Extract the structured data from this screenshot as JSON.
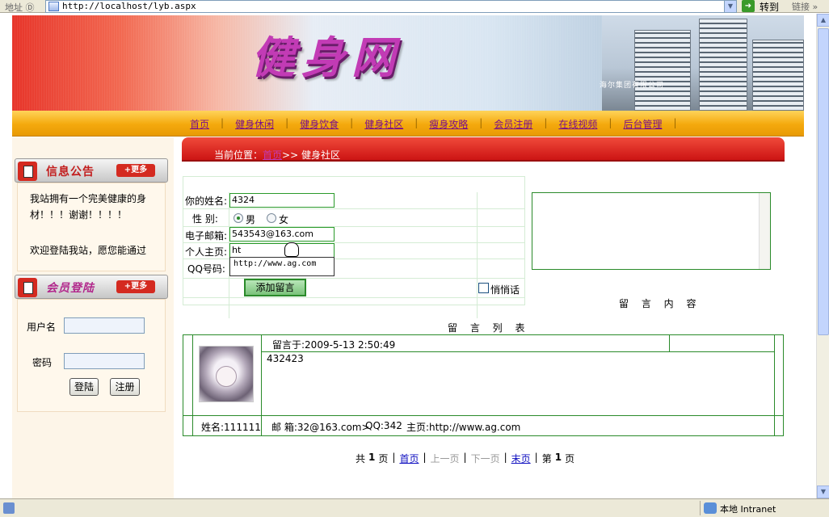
{
  "browser": {
    "address_label": "地址 Ⓓ",
    "url": "http://localhost/lyb.aspx",
    "go_label": "转到",
    "links_label": "链接",
    "arrow": "»",
    "status_zone": "本地 Intranet"
  },
  "banner": {
    "title": "健身网",
    "caption": "海尔集团有限公司"
  },
  "nav": {
    "items": [
      "首页",
      "健身休闲",
      "健身饮食",
      "健身社区",
      "瘦身攻略",
      "会员注册",
      "在线视频",
      "后台管理"
    ]
  },
  "left": {
    "notice_title": "信息公告",
    "more_label": "+更多",
    "notice_lines": [
      "我站拥有一个完美健康的身",
      "材！！！谢谢！！！！",
      "欢迎登陆我站，愿您能通过"
    ],
    "login_title": "会员登陆",
    "username_label": "用户名",
    "password_label": "密码",
    "login_button": "登陆",
    "register_button": "注册"
  },
  "main": {
    "crumb_prefix": "当前位置：",
    "crumb_link": "首页",
    "crumb_suffix": ">> 健身社区",
    "form": {
      "name_label": "你的姓名:",
      "name_value": "4324",
      "gender_label": "性 别:",
      "gender_male": "男",
      "gender_female": "女",
      "email_label": "电子邮箱:",
      "email_value": "543543@163.com",
      "homepage_label": "个人主页:",
      "homepage_value": "ht",
      "qq_label": "QQ号码:",
      "autocomplete_value": "http://www.ag.com",
      "submit_label": "添加留言",
      "quiet_label": "悄悄话",
      "content_label": "留 言 内 容"
    },
    "list_title": "留 言 列 表",
    "messages": [
      {
        "time_text": "留言于:2009-5-13 2:50:49",
        "body": "432423",
        "name_text": "姓名:111111",
        "email_text": "邮 箱:32@163.com>",
        "qq_text": "QQ:342",
        "homepage_text": "主页:http://www.ag.com"
      }
    ],
    "pager": {
      "total_prefix": "共",
      "total_pages": "1",
      "total_suffix": "页",
      "first": "首页",
      "prev": "上一页",
      "next": "下一页",
      "last": "末页",
      "current_prefix": "第",
      "current_page": "1",
      "current_suffix": "页",
      "sep": "|"
    }
  }
}
